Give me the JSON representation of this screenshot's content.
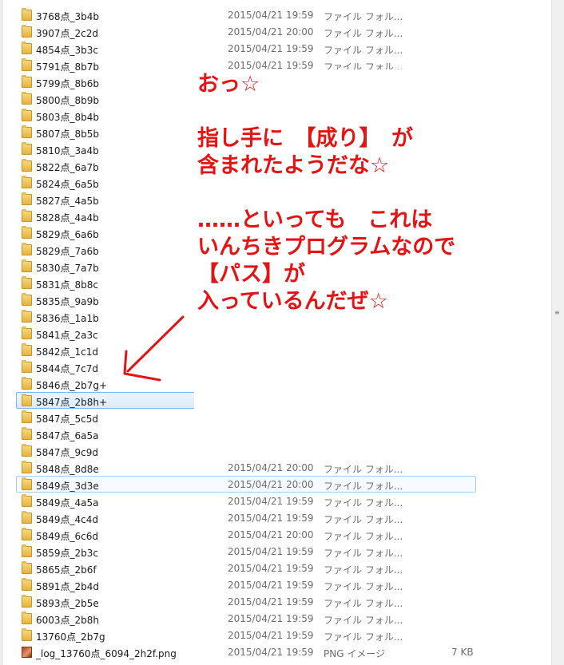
{
  "file_list": {
    "rows": [
      {
        "name": "3768点_3b4b",
        "date": "2015/04/21 19:59",
        "type": "ファイル フォル...",
        "size": "",
        "icon": "folder-icon"
      },
      {
        "name": "3907点_2c2d",
        "date": "2015/04/21 20:00",
        "type": "ファイル フォル...",
        "size": "",
        "icon": "folder-icon"
      },
      {
        "name": "4854点_3b3c",
        "date": "2015/04/21 19:59",
        "type": "ファイル フォル...",
        "size": "",
        "icon": "folder-icon"
      },
      {
        "name": "5791点_8b7b",
        "date": "2015/04/21 19:59",
        "type": "ファイル フォル...",
        "size": "",
        "icon": "folder-icon"
      },
      {
        "name": "5799点_8b6b",
        "date": "",
        "type": "",
        "size": "",
        "icon": "folder-icon"
      },
      {
        "name": "5800点_8b9b",
        "date": "",
        "type": "",
        "size": "",
        "icon": "folder-icon"
      },
      {
        "name": "5803点_8b4b",
        "date": "",
        "type": "",
        "size": "",
        "icon": "folder-icon"
      },
      {
        "name": "5807点_8b5b",
        "date": "",
        "type": "",
        "size": "",
        "icon": "folder-icon"
      },
      {
        "name": "5810点_3a4b",
        "date": "",
        "type": "",
        "size": "",
        "icon": "folder-icon"
      },
      {
        "name": "5822点_6a7b",
        "date": "",
        "type": "",
        "size": "",
        "icon": "folder-icon"
      },
      {
        "name": "5824点_6a5b",
        "date": "",
        "type": "",
        "size": "",
        "icon": "folder-icon"
      },
      {
        "name": "5827点_4a5b",
        "date": "",
        "type": "",
        "size": "",
        "icon": "folder-icon"
      },
      {
        "name": "5828点_4a4b",
        "date": "",
        "type": "",
        "size": "",
        "icon": "folder-icon"
      },
      {
        "name": "5829点_6a6b",
        "date": "",
        "type": "",
        "size": "",
        "icon": "folder-icon"
      },
      {
        "name": "5829点_7a6b",
        "date": "",
        "type": "",
        "size": "",
        "icon": "folder-icon"
      },
      {
        "name": "5830点_7a7b",
        "date": "",
        "type": "",
        "size": "",
        "icon": "folder-icon"
      },
      {
        "name": "5831点_8b8c",
        "date": "",
        "type": "",
        "size": "",
        "icon": "folder-icon"
      },
      {
        "name": "5835点_9a9b",
        "date": "",
        "type": "",
        "size": "",
        "icon": "folder-icon"
      },
      {
        "name": "5836点_1a1b",
        "date": "",
        "type": "",
        "size": "",
        "icon": "folder-icon"
      },
      {
        "name": "5841点_2a3c",
        "date": "",
        "type": "",
        "size": "",
        "icon": "folder-icon"
      },
      {
        "name": "5842点_1c1d",
        "date": "",
        "type": "",
        "size": "",
        "icon": "folder-icon"
      },
      {
        "name": "5844点_7c7d",
        "date": "",
        "type": "",
        "size": "",
        "icon": "folder-icon"
      },
      {
        "name": "5846点_2b7g+",
        "date": "",
        "type": "",
        "size": "",
        "icon": "folder-icon"
      },
      {
        "name": "5847点_2b8h+",
        "date": "",
        "type": "",
        "size": "",
        "icon": "folder-icon",
        "state": "selected"
      },
      {
        "name": "5847点_5c5d",
        "date": "",
        "type": "",
        "size": "",
        "icon": "folder-icon"
      },
      {
        "name": "5847点_6a5a",
        "date": "",
        "type": "",
        "size": "",
        "icon": "folder-icon"
      },
      {
        "name": "5847点_9c9d",
        "date": "",
        "type": "",
        "size": "",
        "icon": "folder-icon"
      },
      {
        "name": "5848点_8d8e",
        "date": "2015/04/21 20:00",
        "type": "ファイル フォル...",
        "size": "",
        "icon": "folder-icon"
      },
      {
        "name": "5849点_3d3e",
        "date": "2015/04/21 20:00",
        "type": "ファイル フォル...",
        "size": "",
        "icon": "folder-icon",
        "state": "hover"
      },
      {
        "name": "5849点_4a5a",
        "date": "2015/04/21 19:59",
        "type": "ファイル フォル...",
        "size": "",
        "icon": "folder-icon"
      },
      {
        "name": "5849点_4c4d",
        "date": "2015/04/21 19:59",
        "type": "ファイル フォル...",
        "size": "",
        "icon": "folder-icon"
      },
      {
        "name": "5849点_6c6d",
        "date": "2015/04/21 20:00",
        "type": "ファイル フォル...",
        "size": "",
        "icon": "folder-icon"
      },
      {
        "name": "5859点_2b3c",
        "date": "2015/04/21 19:59",
        "type": "ファイル フォル...",
        "size": "",
        "icon": "folder-icon"
      },
      {
        "name": "5865点_2b6f",
        "date": "2015/04/21 19:59",
        "type": "ファイル フォル...",
        "size": "",
        "icon": "folder-icon"
      },
      {
        "name": "5891点_2b4d",
        "date": "2015/04/21 19:59",
        "type": "ファイル フォル...",
        "size": "",
        "icon": "folder-icon"
      },
      {
        "name": "5893点_2b5e",
        "date": "2015/04/21 19:59",
        "type": "ファイル フォル...",
        "size": "",
        "icon": "folder-icon"
      },
      {
        "name": "6003点_2b8h",
        "date": "2015/04/21 19:59",
        "type": "ファイル フォル...",
        "size": "",
        "icon": "folder-icon"
      },
      {
        "name": "13760点_2b7g",
        "date": "2015/04/21 19:59",
        "type": "ファイル フォル...",
        "size": "",
        "icon": "folder-icon"
      },
      {
        "name": "_log_13760点_6094_2h2f.png",
        "date": "2015/04/21 19:59",
        "type": "PNG イメージ",
        "size": "7 KB",
        "icon": "png-image-icon"
      }
    ]
  },
  "annotation": {
    "text": "おっ☆\n\n指し手に　【成り】　が\n含まれたようだな☆\n\n……といっても　これは\nいんちきプログラムなので\n【パス】が\n入っているんだぜ☆",
    "color": "#e41414",
    "arrow_color": "#e41414"
  },
  "colors": {
    "selection_border": "#7eb4ea",
    "hover_border": "#a9cdf2",
    "secondary_text": "#6d6d6d"
  }
}
